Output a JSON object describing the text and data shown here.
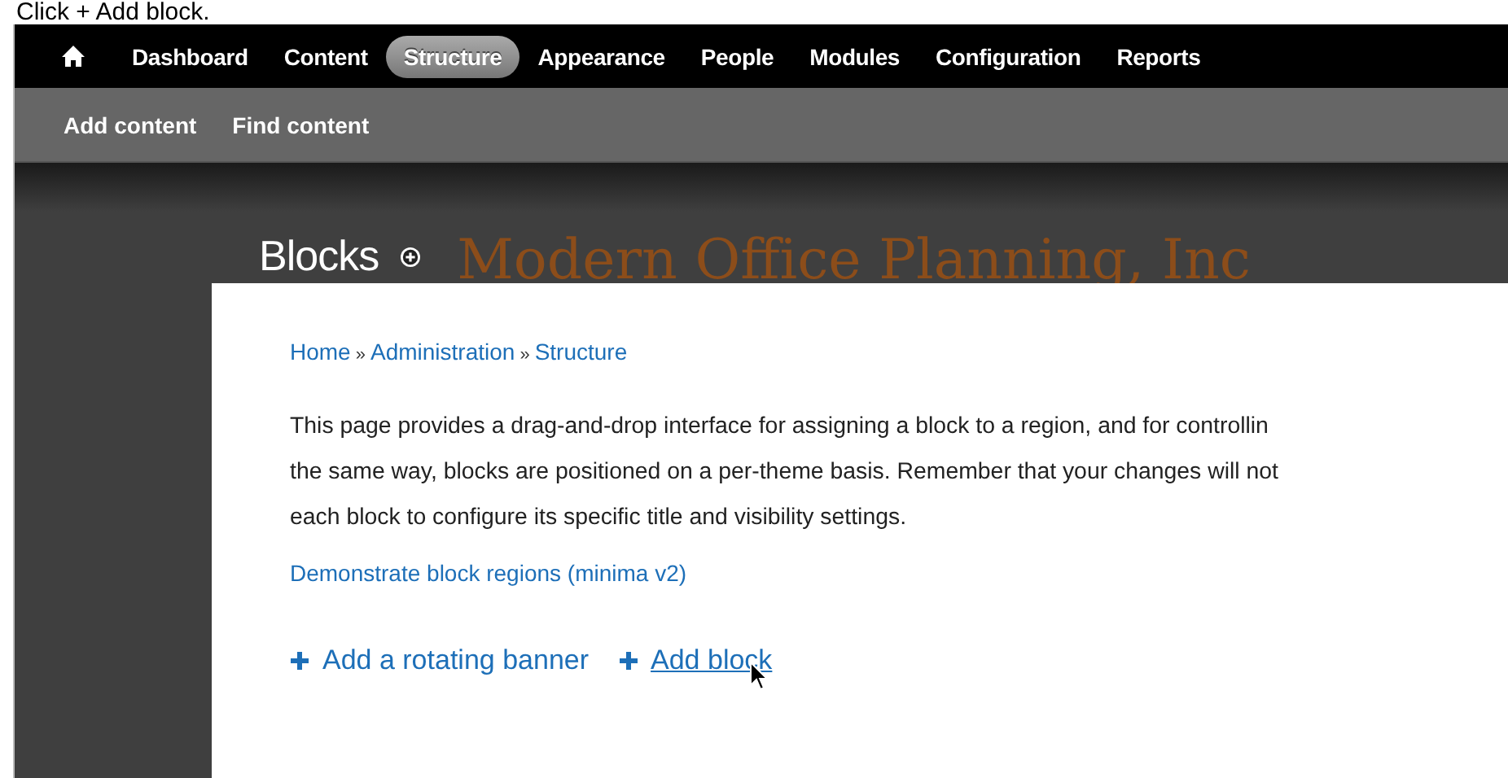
{
  "caption": "Click + Add block.",
  "toolbar": {
    "menu": [
      {
        "label": "Dashboard",
        "selected": false
      },
      {
        "label": "Content",
        "selected": false
      },
      {
        "label": "Structure",
        "selected": true
      },
      {
        "label": "Appearance",
        "selected": false
      },
      {
        "label": "People",
        "selected": false
      },
      {
        "label": "Modules",
        "selected": false
      },
      {
        "label": "Configuration",
        "selected": false
      },
      {
        "label": "Reports",
        "selected": false
      }
    ],
    "shortcuts": [
      "Add content",
      "Find content"
    ]
  },
  "page": {
    "title": "Blocks",
    "site_name": "Modern Office Planning, Inc",
    "breadcrumb": [
      "Home",
      "Administration",
      "Structure"
    ],
    "breadcrumb_separator": "»",
    "description_lines": [
      "This page provides a drag-and-drop interface for assigning a block to a region, and for controllin",
      "the same way, blocks are positioned on a per-theme basis. Remember that your changes will not",
      "each block to configure its specific title and visibility settings."
    ],
    "demo_link": "Demonstrate block regions (minima v2)",
    "actions": [
      {
        "label": "Add a rotating banner",
        "hovered": false
      },
      {
        "label": "Add block",
        "hovered": true
      }
    ]
  }
}
